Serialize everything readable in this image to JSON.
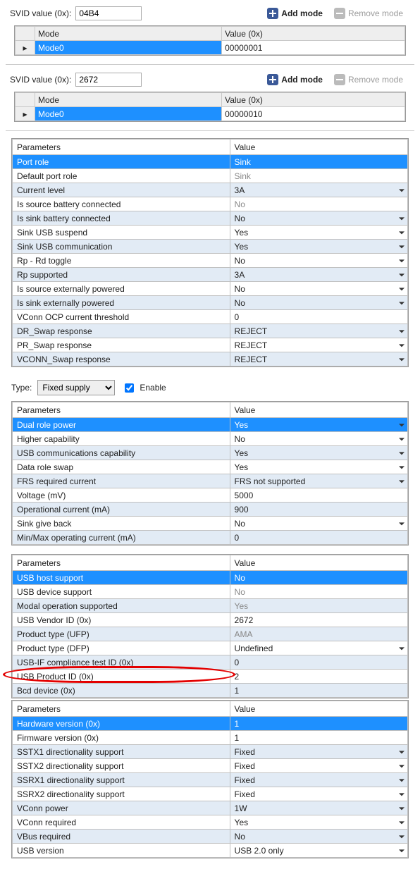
{
  "svid_sections": [
    {
      "label": "SVID value (0x):",
      "value": "04B4",
      "mode_header": "Mode",
      "value_header": "Value (0x)",
      "mode_name": "Mode0",
      "mode_value": "00000001"
    },
    {
      "label": "SVID value (0x):",
      "value": "2672",
      "mode_header": "Mode",
      "value_header": "Value (0x)",
      "mode_name": "Mode0",
      "mode_value": "00000010"
    }
  ],
  "buttons": {
    "add_mode": "Add mode",
    "remove_mode": "Remove mode"
  },
  "type_row": {
    "label": "Type:",
    "value": "Fixed supply",
    "enable_label": "Enable",
    "enable_checked": true
  },
  "tables": {
    "headers": {
      "param": "Parameters",
      "value": "Value"
    },
    "t1": {
      "highlight_idx": 0,
      "rows": [
        {
          "p": "Port role",
          "v": "Sink",
          "gray": true,
          "dd": false
        },
        {
          "p": "Default port role",
          "v": "Sink",
          "gray": true,
          "dd": false
        },
        {
          "p": "Current level",
          "v": "3A",
          "dd": true
        },
        {
          "p": "Is source battery connected",
          "v": "No",
          "gray": true,
          "dd": false
        },
        {
          "p": "Is sink battery connected",
          "v": "No",
          "dd": true
        },
        {
          "p": "Sink USB suspend",
          "v": "Yes",
          "dd": true
        },
        {
          "p": "Sink USB communication",
          "v": "Yes",
          "dd": true
        },
        {
          "p": "Rp - Rd toggle",
          "v": "No",
          "dd": true
        },
        {
          "p": "Rp supported",
          "v": "3A",
          "dd": true
        },
        {
          "p": "Is source externally powered",
          "v": "No",
          "dd": true
        },
        {
          "p": "Is sink externally powered",
          "v": "No",
          "dd": true
        },
        {
          "p": "VConn OCP current threshold",
          "v": "0",
          "dd": false
        },
        {
          "p": "DR_Swap response",
          "v": "REJECT",
          "dd": true
        },
        {
          "p": "PR_Swap response",
          "v": "REJECT",
          "dd": true
        },
        {
          "p": "VCONN_Swap response",
          "v": "REJECT",
          "dd": true
        }
      ]
    },
    "t2": {
      "highlight_idx": 0,
      "rows": [
        {
          "p": "Dual role power",
          "v": "Yes",
          "dd": true
        },
        {
          "p": "Higher capability",
          "v": "No",
          "dd": true
        },
        {
          "p": "USB communications capability",
          "v": "Yes",
          "dd": true
        },
        {
          "p": "Data role swap",
          "v": "Yes",
          "dd": true
        },
        {
          "p": "FRS required current",
          "v": "FRS not supported",
          "dd": true
        },
        {
          "p": "Voltage (mV)",
          "v": "5000",
          "dd": false
        },
        {
          "p": "Operational current (mA)",
          "v": "900",
          "dd": false
        },
        {
          "p": "Sink give back",
          "v": "No",
          "dd": true
        },
        {
          "p": "Min/Max operating current (mA)",
          "v": "0",
          "dd": false
        }
      ]
    },
    "t3": {
      "highlight_idx": 0,
      "annot_idx": 7,
      "rows": [
        {
          "p": "USB host support",
          "v": "No",
          "gray": true,
          "dd": false
        },
        {
          "p": "USB device support",
          "v": "No",
          "gray": true,
          "dd": false
        },
        {
          "p": "Modal operation supported",
          "v": "Yes",
          "gray": true,
          "dd": false
        },
        {
          "p": "USB Vendor ID (0x)",
          "v": "2672",
          "dd": false
        },
        {
          "p": "Product type (UFP)",
          "v": "AMA",
          "gray": true,
          "dd": false
        },
        {
          "p": "Product type (DFP)",
          "v": "Undefined",
          "dd": true
        },
        {
          "p": "USB-IF compliance test ID (0x)",
          "v": "0",
          "dd": false
        },
        {
          "p": "USB Product ID (0x)",
          "v": "2",
          "dd": false
        },
        {
          "p": "Bcd device (0x)",
          "v": "1",
          "dd": false
        }
      ]
    },
    "t4": {
      "highlight_idx": 0,
      "rows": [
        {
          "p": "Hardware version (0x)",
          "v": "1",
          "dd": false
        },
        {
          "p": "Firmware version (0x)",
          "v": "1",
          "dd": false
        },
        {
          "p": "SSTX1 directionality support",
          "v": "Fixed",
          "dd": true
        },
        {
          "p": "SSTX2 directionality support",
          "v": "Fixed",
          "dd": true
        },
        {
          "p": "SSRX1 directionality support",
          "v": "Fixed",
          "dd": true
        },
        {
          "p": "SSRX2 directionality support",
          "v": "Fixed",
          "dd": true
        },
        {
          "p": "VConn power",
          "v": "1W",
          "dd": true
        },
        {
          "p": "VConn required",
          "v": "Yes",
          "dd": true
        },
        {
          "p": "VBus required",
          "v": "No",
          "dd": true
        },
        {
          "p": "USB version",
          "v": "USB 2.0 only",
          "dd": true
        }
      ]
    }
  }
}
